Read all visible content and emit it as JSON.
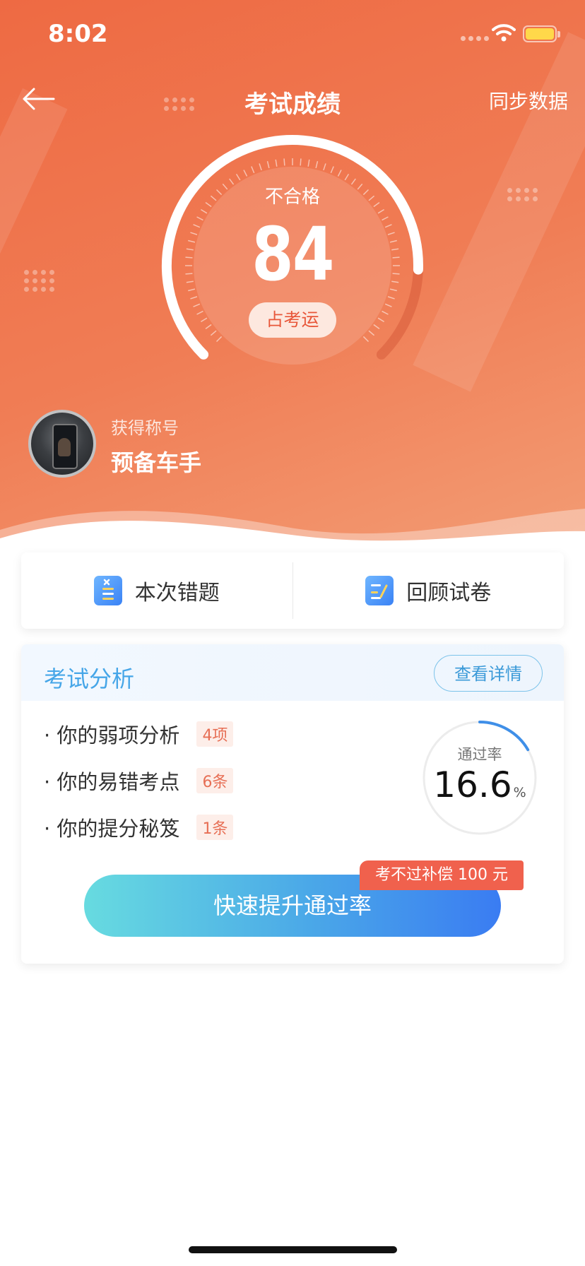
{
  "status_bar": {
    "time": "8:02"
  },
  "header": {
    "title": "考试成绩",
    "sync_label": "同步数据"
  },
  "result": {
    "status": "不合格",
    "score": "84",
    "score_fraction": 0.84,
    "fortune_button": "占考运"
  },
  "user": {
    "title_label": "获得称号",
    "title_value": "预备车手"
  },
  "actions": {
    "wrong_questions": "本次错题",
    "review_paper": "回顾试卷"
  },
  "analysis": {
    "heading": "考试分析",
    "detail_button": "查看详情",
    "items": [
      {
        "label": "· 你的弱项分析",
        "tag": "4项"
      },
      {
        "label": "· 你的易错考点",
        "tag": "6条"
      },
      {
        "label": "· 你的提分秘笈",
        "tag": "1条"
      }
    ],
    "pass_rate_label": "通过率",
    "pass_rate_value": "16.6",
    "pass_rate_unit": "%",
    "pass_rate_fraction": 0.166,
    "cta_label": "快速提升通过率",
    "cta_badge": "考不过补偿 100 元"
  },
  "colors": {
    "hero_start": "#ee6a43",
    "hero_end": "#f39c74",
    "accent_blue": "#46a6e8",
    "tag_red": "#e76f55",
    "cta_start": "#67dbe0",
    "cta_end": "#3a7cf2"
  }
}
